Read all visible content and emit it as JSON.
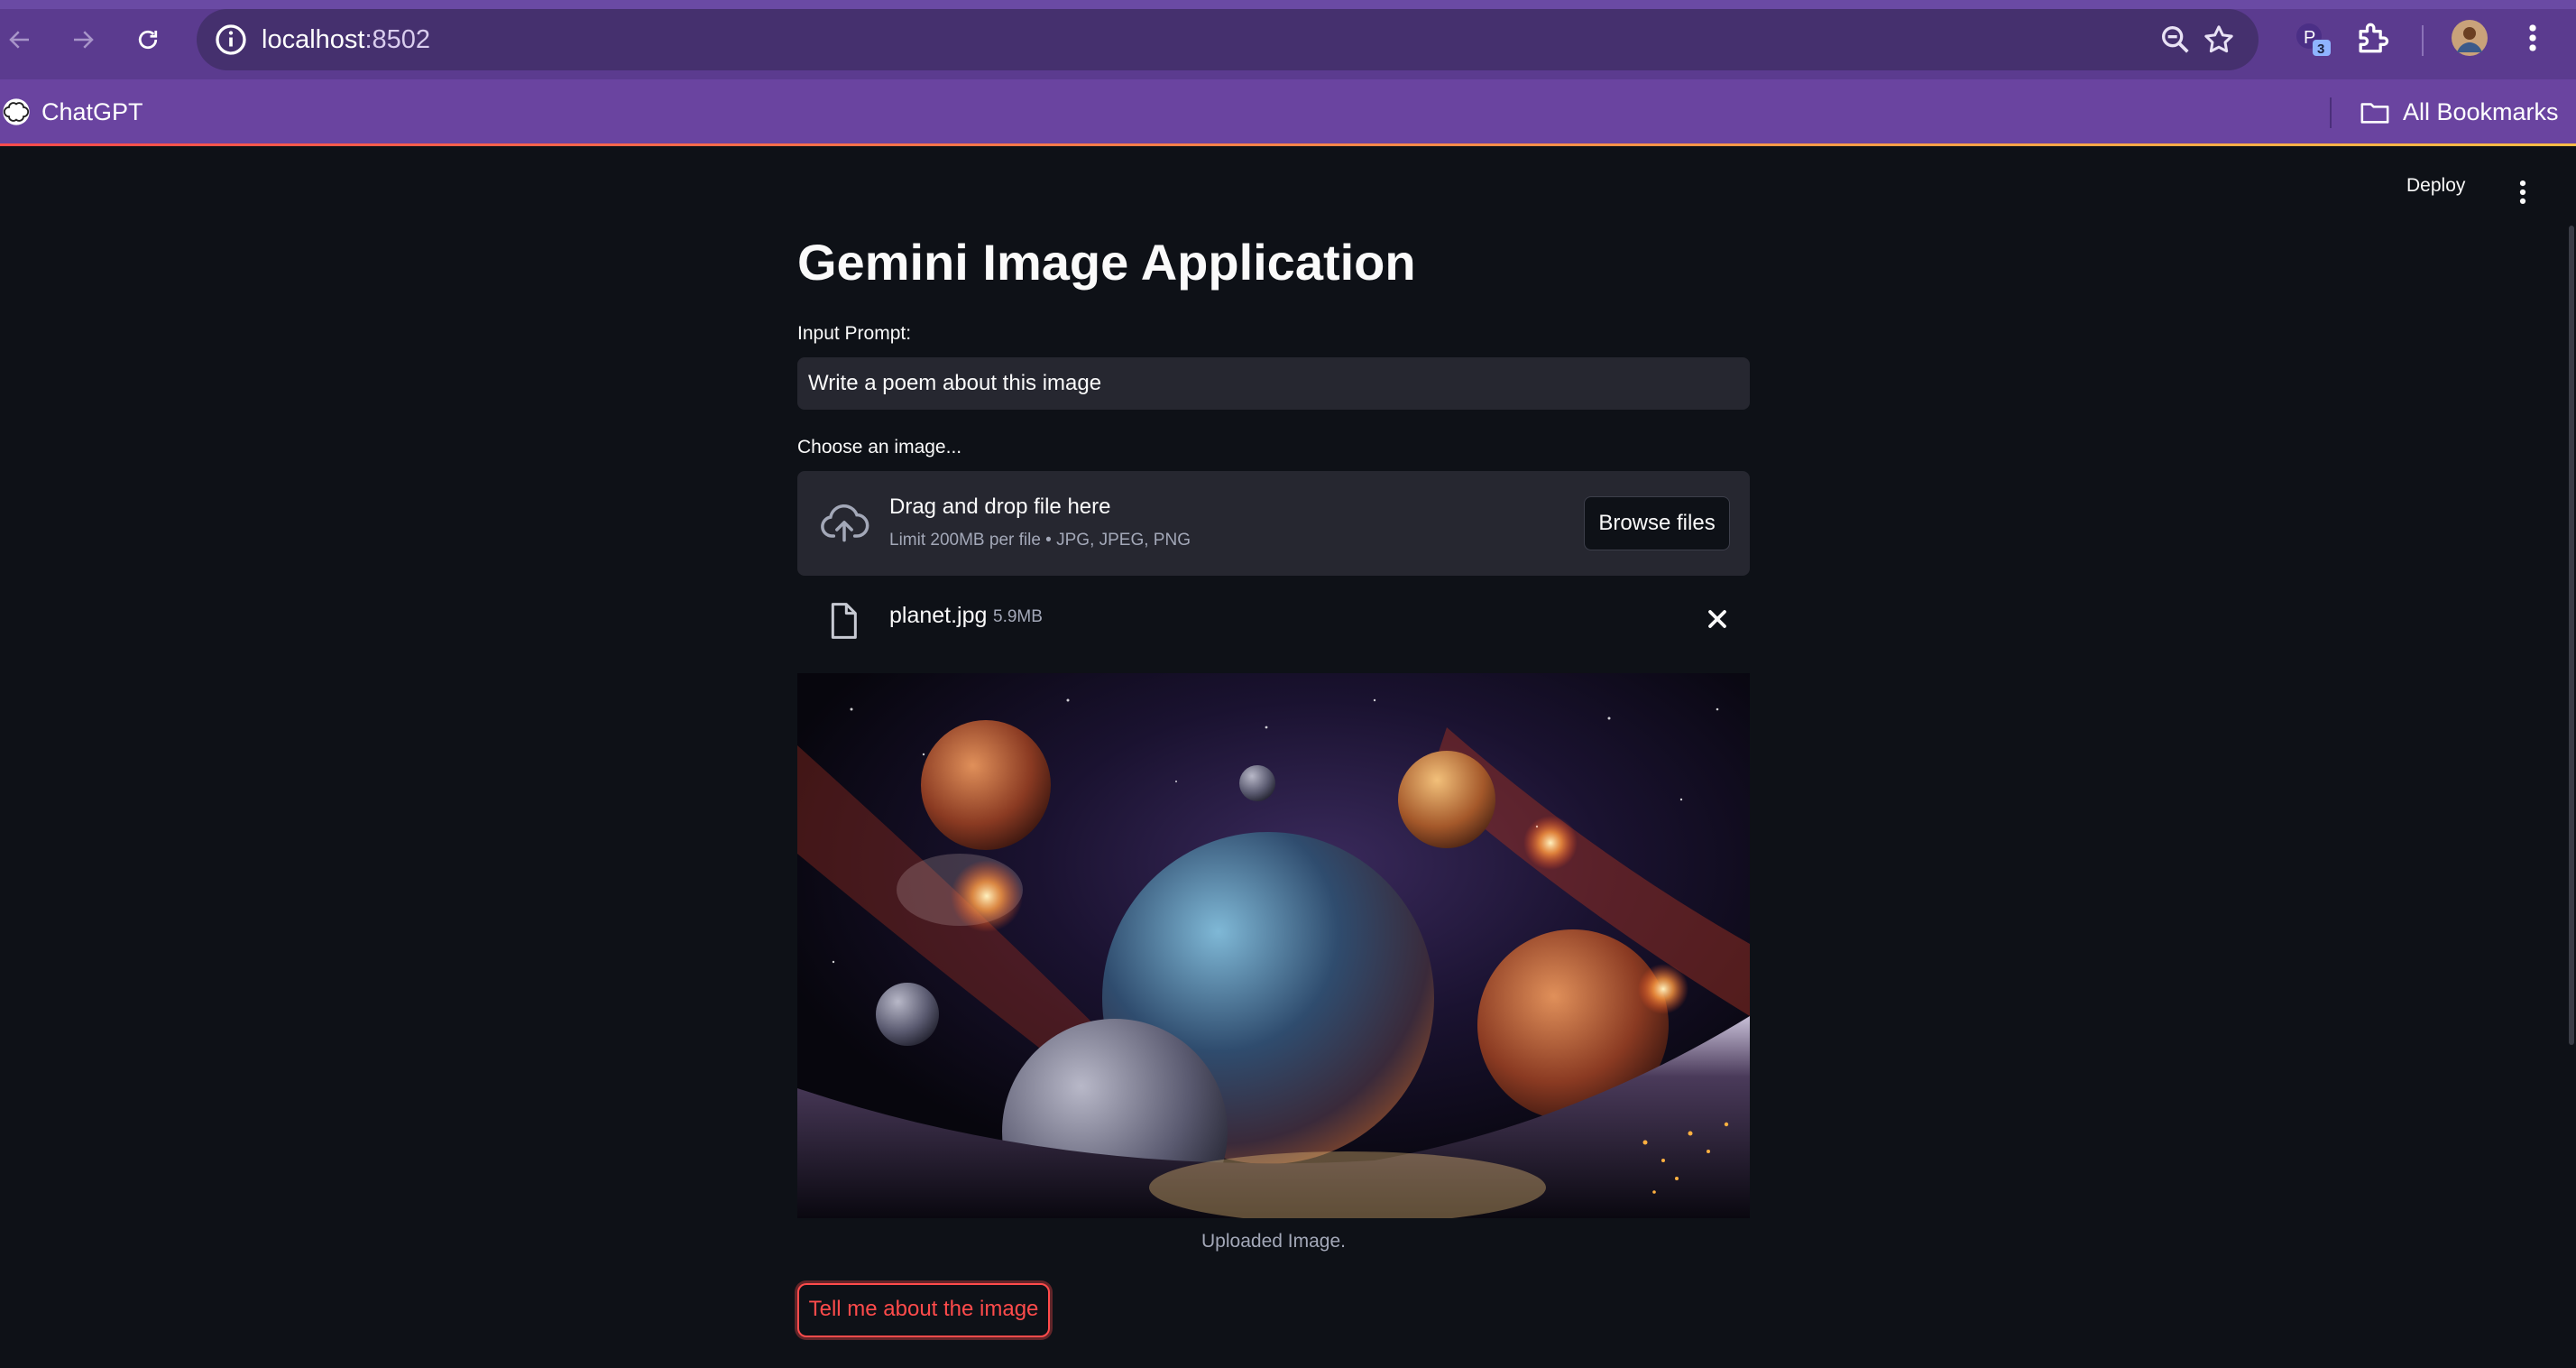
{
  "browser": {
    "url_host": "localhost",
    "url_port": ":8502",
    "extension_badge": "3",
    "extension_letter": "P",
    "bookmarks": [
      {
        "label": "ChatGPT"
      }
    ],
    "all_bookmarks_label": "All Bookmarks"
  },
  "app": {
    "deploy_label": "Deploy",
    "title": "Gemini Image Application",
    "prompt_label": "Input Prompt:",
    "prompt_value": "Write a poem about this image",
    "uploader_label": "Choose an image...",
    "dropzone_main": "Drag and drop file here",
    "dropzone_sub": "Limit 200MB per file • JPG, JPEG, PNG",
    "browse_label": "Browse files",
    "file": {
      "name": "planet.jpg",
      "size": "5.9MB"
    },
    "image_caption": "Uploaded Image.",
    "submit_label": "Tell me about the image"
  },
  "colors": {
    "browser_frame": "#5b3b8f",
    "bookmarks_bar": "#6a44a0",
    "app_background": "#0e1117",
    "input_background": "#262730",
    "accent": "#ff4b4b"
  },
  "icons": [
    "back-arrow-icon",
    "forward-arrow-icon",
    "reload-icon",
    "site-info-icon",
    "zoom-icon",
    "bookmark-star-icon",
    "extensions-puzzle-icon",
    "profile-avatar",
    "chrome-menu-icon",
    "chatgpt-logo-icon",
    "folder-icon",
    "kebab-menu-icon",
    "cloud-upload-icon",
    "file-icon",
    "close-icon"
  ]
}
